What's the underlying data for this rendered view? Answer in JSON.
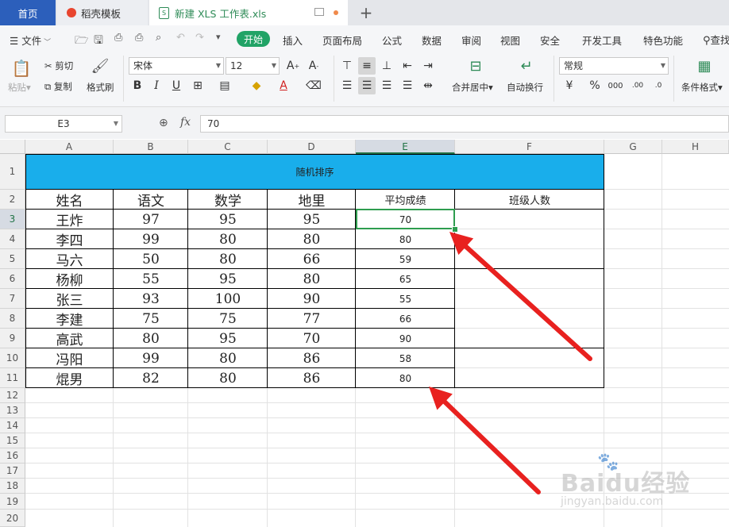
{
  "tabs": [
    {
      "label": "首页"
    },
    {
      "label": "稻壳模板"
    },
    {
      "label": "新建 XLS 工作表.xls"
    }
  ],
  "menu": {
    "file": "文件",
    "items": [
      "开始",
      "插入",
      "页面布局",
      "公式",
      "数据",
      "审阅",
      "视图",
      "安全",
      "开发工具",
      "特色功能"
    ],
    "search": "查找"
  },
  "ribbon": {
    "paste": "粘贴",
    "cut": "剪切",
    "copy": "复制",
    "format_painter": "格式刷",
    "font_name": "宋体",
    "font_size": "12",
    "merge_center": "合并居中",
    "wrap_text": "自动换行",
    "number_format": "常规",
    "conditional_format": "条件格式"
  },
  "formula_bar": {
    "name_box": "E3",
    "fx_label": "fx",
    "value": "70"
  },
  "sheet": {
    "columns": [
      "A",
      "B",
      "C",
      "D",
      "E",
      "F",
      "G",
      "H"
    ],
    "rows": [
      "1",
      "2",
      "3",
      "4",
      "5",
      "6",
      "7",
      "8",
      "9",
      "10",
      "11",
      "12",
      "13",
      "14",
      "15",
      "16",
      "17",
      "18",
      "19",
      "20"
    ],
    "title": "随机排序",
    "headers": [
      "姓名",
      "语文",
      "数学",
      "地里",
      "平均成绩",
      "班级人数"
    ],
    "records": [
      [
        "王炸",
        "97",
        "95",
        "95",
        "70"
      ],
      [
        "李四",
        "99",
        "80",
        "80",
        "80"
      ],
      [
        "马六",
        "50",
        "80",
        "66",
        "59"
      ],
      [
        "杨柳",
        "55",
        "95",
        "80",
        "65"
      ],
      [
        "张三",
        "93",
        "100",
        "90",
        "55"
      ],
      [
        "李建",
        "75",
        "75",
        "77",
        "66"
      ],
      [
        "高武",
        "80",
        "95",
        "70",
        "90"
      ],
      [
        "冯阳",
        "99",
        "80",
        "86",
        "58"
      ],
      [
        "焜男",
        "82",
        "80",
        "86",
        "80"
      ]
    ],
    "selected_cell": "E3"
  },
  "annotations": {
    "arrow_color": "#e8211f"
  },
  "watermark": {
    "brand": "Baidu经验",
    "url": "jingyan.baidu.com"
  },
  "colors": {
    "title_band": "#19aeeb",
    "home_tab": "#2c5fbb",
    "start_button": "#21a366",
    "selection": "#2e9d4f"
  }
}
